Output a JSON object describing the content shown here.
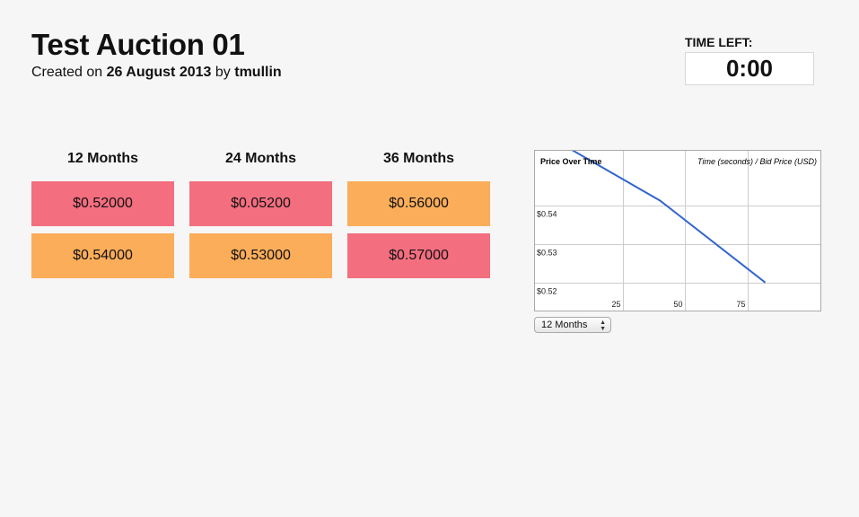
{
  "header": {
    "title": "Test Auction 01",
    "created_prefix": "Created on",
    "created_date": "26 August 2013",
    "created_by_word": "by",
    "created_user": "tmullin"
  },
  "timer": {
    "label": "TIME LEFT:",
    "value": "0:00"
  },
  "columns": [
    {
      "label": "12 Months",
      "bids": [
        {
          "value": "$0.52000",
          "status": "red"
        },
        {
          "value": "$0.54000",
          "status": "orange"
        }
      ]
    },
    {
      "label": "24 Months",
      "bids": [
        {
          "value": "$0.05200",
          "status": "red"
        },
        {
          "value": "$0.53000",
          "status": "orange"
        }
      ]
    },
    {
      "label": "36 Months",
      "bids": [
        {
          "value": "$0.56000",
          "status": "orange"
        },
        {
          "value": "$0.57000",
          "status": "red"
        }
      ]
    }
  ],
  "colors": {
    "red": "#f36e7f",
    "orange": "#fbad5a",
    "line": "#3366cc"
  },
  "chart_data": {
    "type": "line",
    "title": "Price Over Time",
    "subtitle": "Time (seconds) / Bid Price (USD)",
    "x": [
      0,
      40,
      82
    ],
    "y": [
      0.5563,
      0.5413,
      0.52
    ],
    "xlim": [
      -10,
      104
    ],
    "ylim": [
      0.5127,
      0.5543
    ],
    "xticks": [
      25,
      50,
      75
    ],
    "yticks": [
      0.54,
      0.53,
      0.52
    ],
    "xtick_labels": [
      "25",
      "50",
      "75"
    ],
    "ytick_labels": [
      "$0.54",
      "$0.53",
      "$0.52"
    ],
    "grid": true
  },
  "series_select": {
    "selected": "12 Months"
  }
}
